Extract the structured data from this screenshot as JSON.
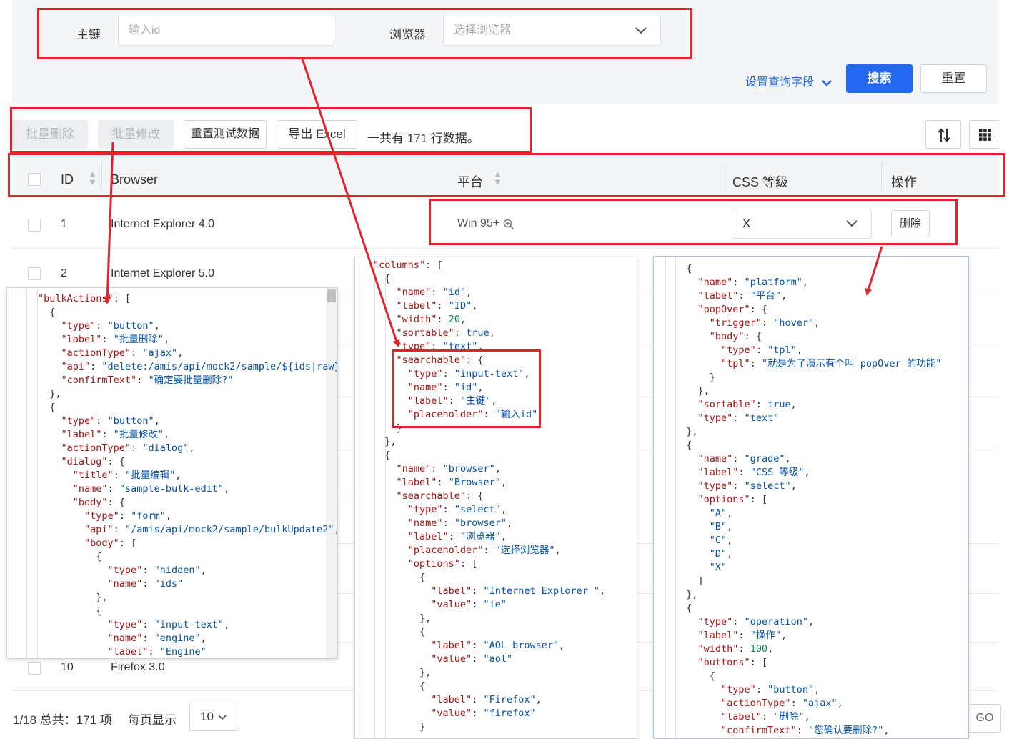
{
  "search": {
    "id_label": "主键",
    "id_placeholder": "输入id",
    "browser_label": "浏览器",
    "browser_placeholder": "选择浏览器",
    "set_fields": "设置查询字段",
    "search_button": "搜索",
    "reset_button": "重置"
  },
  "toolbar": {
    "bulk_delete": "批量删除",
    "bulk_edit": "批量修改",
    "reset_data": "重置测试数据",
    "export_excel": "导出 Excel",
    "summary": "一共有 171 行数据。"
  },
  "table": {
    "headers": {
      "id": "ID",
      "browser": "Browser",
      "platform": "平台",
      "grade": "CSS 等级",
      "operation": "操作"
    },
    "rows": [
      {
        "id": "1",
        "browser": "Internet Explorer 4.0",
        "platform": "Win 95+",
        "grade": "X",
        "action": "删除"
      },
      {
        "id": "2",
        "browser": "Internet Explorer 5.0"
      },
      {
        "id": "10",
        "browser": "Firefox 3.0"
      }
    ]
  },
  "pager": {
    "summary": "1/18 总共：171 项",
    "per_page_label": "每页显示",
    "per_page_value": "10",
    "go": "GO"
  },
  "code_left": [
    [
      [
        "k",
        "\"bulkActions\""
      ],
      [
        "p",
        ": ["
      ]
    ],
    [
      [
        "p",
        "  {"
      ]
    ],
    [
      [
        "p",
        "    "
      ],
      [
        "k",
        "\"type\""
      ],
      [
        "p",
        ": "
      ],
      [
        "s",
        "\"button\""
      ],
      [
        "p",
        ","
      ]
    ],
    [
      [
        "p",
        "    "
      ],
      [
        "k",
        "\"label\""
      ],
      [
        "p",
        ": "
      ],
      [
        "s",
        "\"批量删除\""
      ],
      [
        "p",
        ","
      ]
    ],
    [
      [
        "p",
        "    "
      ],
      [
        "k",
        "\"actionType\""
      ],
      [
        "p",
        ": "
      ],
      [
        "s",
        "\"ajax\""
      ],
      [
        "p",
        ","
      ]
    ],
    [
      [
        "p",
        "    "
      ],
      [
        "k",
        "\"api\""
      ],
      [
        "p",
        ": "
      ],
      [
        "s",
        "\"delete:/amis/api/mock2/sample/${ids|raw}\""
      ],
      [
        "p",
        ","
      ]
    ],
    [
      [
        "p",
        "    "
      ],
      [
        "k",
        "\"confirmText\""
      ],
      [
        "p",
        ": "
      ],
      [
        "s",
        "\"确定要批量删除?\""
      ]
    ],
    [
      [
        "p",
        "  },"
      ]
    ],
    [
      [
        "p",
        "  {"
      ]
    ],
    [
      [
        "p",
        "    "
      ],
      [
        "k",
        "\"type\""
      ],
      [
        "p",
        ": "
      ],
      [
        "s",
        "\"button\""
      ],
      [
        "p",
        ","
      ]
    ],
    [
      [
        "p",
        "    "
      ],
      [
        "k",
        "\"label\""
      ],
      [
        "p",
        ": "
      ],
      [
        "s",
        "\"批量修改\""
      ],
      [
        "p",
        ","
      ]
    ],
    [
      [
        "p",
        "    "
      ],
      [
        "k",
        "\"actionType\""
      ],
      [
        "p",
        ": "
      ],
      [
        "s",
        "\"dialog\""
      ],
      [
        "p",
        ","
      ]
    ],
    [
      [
        "p",
        "    "
      ],
      [
        "k",
        "\"dialog\""
      ],
      [
        "p",
        ": {"
      ]
    ],
    [
      [
        "p",
        "      "
      ],
      [
        "k",
        "\"title\""
      ],
      [
        "p",
        ": "
      ],
      [
        "s",
        "\"批量编辑\""
      ],
      [
        "p",
        ","
      ]
    ],
    [
      [
        "p",
        "      "
      ],
      [
        "k",
        "\"name\""
      ],
      [
        "p",
        ": "
      ],
      [
        "s",
        "\"sample-bulk-edit\""
      ],
      [
        "p",
        ","
      ]
    ],
    [
      [
        "p",
        "      "
      ],
      [
        "k",
        "\"body\""
      ],
      [
        "p",
        ": {"
      ]
    ],
    [
      [
        "p",
        "        "
      ],
      [
        "k",
        "\"type\""
      ],
      [
        "p",
        ": "
      ],
      [
        "s",
        "\"form\""
      ],
      [
        "p",
        ","
      ]
    ],
    [
      [
        "p",
        "        "
      ],
      [
        "k",
        "\"api\""
      ],
      [
        "p",
        ": "
      ],
      [
        "s",
        "\"/amis/api/mock2/sample/bulkUpdate2\""
      ],
      [
        "p",
        ","
      ]
    ],
    [
      [
        "p",
        "        "
      ],
      [
        "k",
        "\"body\""
      ],
      [
        "p",
        ": ["
      ]
    ],
    [
      [
        "p",
        "          {"
      ]
    ],
    [
      [
        "p",
        "            "
      ],
      [
        "k",
        "\"type\""
      ],
      [
        "p",
        ": "
      ],
      [
        "s",
        "\"hidden\""
      ],
      [
        "p",
        ","
      ]
    ],
    [
      [
        "p",
        "            "
      ],
      [
        "k",
        "\"name\""
      ],
      [
        "p",
        ": "
      ],
      [
        "s",
        "\"ids\""
      ]
    ],
    [
      [
        "p",
        "          },"
      ]
    ],
    [
      [
        "p",
        "          {"
      ]
    ],
    [
      [
        "p",
        "            "
      ],
      [
        "k",
        "\"type\""
      ],
      [
        "p",
        ": "
      ],
      [
        "s",
        "\"input-text\""
      ],
      [
        "p",
        ","
      ]
    ],
    [
      [
        "p",
        "            "
      ],
      [
        "k",
        "\"name\""
      ],
      [
        "p",
        ": "
      ],
      [
        "s",
        "\"engine\""
      ],
      [
        "p",
        ","
      ]
    ],
    [
      [
        "p",
        "            "
      ],
      [
        "k",
        "\"label\""
      ],
      [
        "p",
        ": "
      ],
      [
        "s",
        "\"Engine\""
      ]
    ]
  ],
  "code_middle": [
    [
      [
        "k",
        "\"columns\""
      ],
      [
        "p",
        ": ["
      ]
    ],
    [
      [
        "p",
        "  {"
      ]
    ],
    [
      [
        "p",
        "    "
      ],
      [
        "k",
        "\"name\""
      ],
      [
        "p",
        ": "
      ],
      [
        "s",
        "\"id\""
      ],
      [
        "p",
        ","
      ]
    ],
    [
      [
        "p",
        "    "
      ],
      [
        "k",
        "\"label\""
      ],
      [
        "p",
        ": "
      ],
      [
        "s",
        "\"ID\""
      ],
      [
        "p",
        ","
      ]
    ],
    [
      [
        "p",
        "    "
      ],
      [
        "k",
        "\"width\""
      ],
      [
        "p",
        ": "
      ],
      [
        "n",
        "20"
      ],
      [
        "p",
        ","
      ]
    ],
    [
      [
        "p",
        "    "
      ],
      [
        "k",
        "\"sortable\""
      ],
      [
        "p",
        ": "
      ],
      [
        "s",
        "true"
      ],
      [
        "p",
        ","
      ]
    ],
    [
      [
        "p",
        "    "
      ],
      [
        "k",
        "\"type\""
      ],
      [
        "p",
        ": "
      ],
      [
        "s",
        "\"text\""
      ],
      [
        "p",
        ","
      ]
    ],
    [
      [
        "p",
        "    "
      ],
      [
        "k",
        "\"searchable\""
      ],
      [
        "p",
        ": {"
      ]
    ],
    [
      [
        "p",
        "      "
      ],
      [
        "k",
        "\"type\""
      ],
      [
        "p",
        ": "
      ],
      [
        "s",
        "\"input-text\""
      ],
      [
        "p",
        ","
      ]
    ],
    [
      [
        "p",
        "      "
      ],
      [
        "k",
        "\"name\""
      ],
      [
        "p",
        ": "
      ],
      [
        "s",
        "\"id\""
      ],
      [
        "p",
        ","
      ]
    ],
    [
      [
        "p",
        "      "
      ],
      [
        "k",
        "\"label\""
      ],
      [
        "p",
        ": "
      ],
      [
        "s",
        "\"主键\""
      ],
      [
        "p",
        ","
      ]
    ],
    [
      [
        "p",
        "      "
      ],
      [
        "k",
        "\"placeholder\""
      ],
      [
        "p",
        ": "
      ],
      [
        "s",
        "\"输入id\""
      ]
    ],
    [
      [
        "p",
        "    }"
      ]
    ],
    [
      [
        "p",
        "  },"
      ]
    ],
    [
      [
        "p",
        "  {"
      ]
    ],
    [
      [
        "p",
        "    "
      ],
      [
        "k",
        "\"name\""
      ],
      [
        "p",
        ": "
      ],
      [
        "s",
        "\"browser\""
      ],
      [
        "p",
        ","
      ]
    ],
    [
      [
        "p",
        "    "
      ],
      [
        "k",
        "\"label\""
      ],
      [
        "p",
        ": "
      ],
      [
        "s",
        "\"Browser\""
      ],
      [
        "p",
        ","
      ]
    ],
    [
      [
        "p",
        "    "
      ],
      [
        "k",
        "\"searchable\""
      ],
      [
        "p",
        ": {"
      ]
    ],
    [
      [
        "p",
        "      "
      ],
      [
        "k",
        "\"type\""
      ],
      [
        "p",
        ": "
      ],
      [
        "s",
        "\"select\""
      ],
      [
        "p",
        ","
      ]
    ],
    [
      [
        "p",
        "      "
      ],
      [
        "k",
        "\"name\""
      ],
      [
        "p",
        ": "
      ],
      [
        "s",
        "\"browser\""
      ],
      [
        "p",
        ","
      ]
    ],
    [
      [
        "p",
        "      "
      ],
      [
        "k",
        "\"label\""
      ],
      [
        "p",
        ": "
      ],
      [
        "s",
        "\"浏览器\""
      ],
      [
        "p",
        ","
      ]
    ],
    [
      [
        "p",
        "      "
      ],
      [
        "k",
        "\"placeholder\""
      ],
      [
        "p",
        ": "
      ],
      [
        "s",
        "\"选择浏览器\""
      ],
      [
        "p",
        ","
      ]
    ],
    [
      [
        "p",
        "      "
      ],
      [
        "k",
        "\"options\""
      ],
      [
        "p",
        ": ["
      ]
    ],
    [
      [
        "p",
        "        {"
      ]
    ],
    [
      [
        "p",
        "          "
      ],
      [
        "k",
        "\"label\""
      ],
      [
        "p",
        ": "
      ],
      [
        "s",
        "\"Internet Explorer \""
      ],
      [
        "p",
        ","
      ]
    ],
    [
      [
        "p",
        "          "
      ],
      [
        "k",
        "\"value\""
      ],
      [
        "p",
        ": "
      ],
      [
        "s",
        "\"ie\""
      ]
    ],
    [
      [
        "p",
        "        },"
      ]
    ],
    [
      [
        "p",
        "        {"
      ]
    ],
    [
      [
        "p",
        "          "
      ],
      [
        "k",
        "\"label\""
      ],
      [
        "p",
        ": "
      ],
      [
        "s",
        "\"AOL browser\""
      ],
      [
        "p",
        ","
      ]
    ],
    [
      [
        "p",
        "          "
      ],
      [
        "k",
        "\"value\""
      ],
      [
        "p",
        ": "
      ],
      [
        "s",
        "\"aol\""
      ]
    ],
    [
      [
        "p",
        "        },"
      ]
    ],
    [
      [
        "p",
        "        {"
      ]
    ],
    [
      [
        "p",
        "          "
      ],
      [
        "k",
        "\"label\""
      ],
      [
        "p",
        ": "
      ],
      [
        "s",
        "\"Firefox\""
      ],
      [
        "p",
        ","
      ]
    ],
    [
      [
        "p",
        "          "
      ],
      [
        "k",
        "\"value\""
      ],
      [
        "p",
        ": "
      ],
      [
        "s",
        "\"firefox\""
      ]
    ],
    [
      [
        "p",
        "        }"
      ]
    ]
  ],
  "code_right": [
    [
      [
        "p",
        "  {"
      ]
    ],
    [
      [
        "p",
        "    "
      ],
      [
        "k",
        "\"name\""
      ],
      [
        "p",
        ": "
      ],
      [
        "s",
        "\"platform\""
      ],
      [
        "p",
        ","
      ]
    ],
    [
      [
        "p",
        "    "
      ],
      [
        "k",
        "\"label\""
      ],
      [
        "p",
        ": "
      ],
      [
        "s",
        "\"平台\""
      ],
      [
        "p",
        ","
      ]
    ],
    [
      [
        "p",
        "    "
      ],
      [
        "k",
        "\"popOver\""
      ],
      [
        "p",
        ": {"
      ]
    ],
    [
      [
        "p",
        "      "
      ],
      [
        "k",
        "\"trigger\""
      ],
      [
        "p",
        ": "
      ],
      [
        "s",
        "\"hover\""
      ],
      [
        "p",
        ","
      ]
    ],
    [
      [
        "p",
        "      "
      ],
      [
        "k",
        "\"body\""
      ],
      [
        "p",
        ": {"
      ]
    ],
    [
      [
        "p",
        "        "
      ],
      [
        "k",
        "\"type\""
      ],
      [
        "p",
        ": "
      ],
      [
        "s",
        "\"tpl\""
      ],
      [
        "p",
        ","
      ]
    ],
    [
      [
        "p",
        "        "
      ],
      [
        "k",
        "\"tpl\""
      ],
      [
        "p",
        ": "
      ],
      [
        "s",
        "\"就是为了演示有个叫 popOver 的功能\""
      ]
    ],
    [
      [
        "p",
        "      }"
      ]
    ],
    [
      [
        "p",
        "    },"
      ]
    ],
    [
      [
        "p",
        "    "
      ],
      [
        "k",
        "\"sortable\""
      ],
      [
        "p",
        ": "
      ],
      [
        "s",
        "true"
      ],
      [
        "p",
        ","
      ]
    ],
    [
      [
        "p",
        "    "
      ],
      [
        "k",
        "\"type\""
      ],
      [
        "p",
        ": "
      ],
      [
        "s",
        "\"text\""
      ]
    ],
    [
      [
        "p",
        "  },"
      ]
    ],
    [
      [
        "p",
        "  {"
      ]
    ],
    [
      [
        "p",
        "    "
      ],
      [
        "k",
        "\"name\""
      ],
      [
        "p",
        ": "
      ],
      [
        "s",
        "\"grade\""
      ],
      [
        "p",
        ","
      ]
    ],
    [
      [
        "p",
        "    "
      ],
      [
        "k",
        "\"label\""
      ],
      [
        "p",
        ": "
      ],
      [
        "s",
        "\"CSS 等级\""
      ],
      [
        "p",
        ","
      ]
    ],
    [
      [
        "p",
        "    "
      ],
      [
        "k",
        "\"type\""
      ],
      [
        "p",
        ": "
      ],
      [
        "s",
        "\"select\""
      ],
      [
        "p",
        ","
      ]
    ],
    [
      [
        "p",
        "    "
      ],
      [
        "k",
        "\"options\""
      ],
      [
        "p",
        ": ["
      ]
    ],
    [
      [
        "p",
        "      "
      ],
      [
        "s",
        "\"A\""
      ],
      [
        "p",
        ","
      ]
    ],
    [
      [
        "p",
        "      "
      ],
      [
        "s",
        "\"B\""
      ],
      [
        "p",
        ","
      ]
    ],
    [
      [
        "p",
        "      "
      ],
      [
        "s",
        "\"C\""
      ],
      [
        "p",
        ","
      ]
    ],
    [
      [
        "p",
        "      "
      ],
      [
        "s",
        "\"D\""
      ],
      [
        "p",
        ","
      ]
    ],
    [
      [
        "p",
        "      "
      ],
      [
        "s",
        "\"X\""
      ]
    ],
    [
      [
        "p",
        "    ]"
      ]
    ],
    [
      [
        "p",
        "  },"
      ]
    ],
    [
      [
        "p",
        "  {"
      ]
    ],
    [
      [
        "p",
        "    "
      ],
      [
        "k",
        "\"type\""
      ],
      [
        "p",
        ": "
      ],
      [
        "s",
        "\"operation\""
      ],
      [
        "p",
        ","
      ]
    ],
    [
      [
        "p",
        "    "
      ],
      [
        "k",
        "\"label\""
      ],
      [
        "p",
        ": "
      ],
      [
        "s",
        "\"操作\""
      ],
      [
        "p",
        ","
      ]
    ],
    [
      [
        "p",
        "    "
      ],
      [
        "k",
        "\"width\""
      ],
      [
        "p",
        ": "
      ],
      [
        "n",
        "100"
      ],
      [
        "p",
        ","
      ]
    ],
    [
      [
        "p",
        "    "
      ],
      [
        "k",
        "\"buttons\""
      ],
      [
        "p",
        ": ["
      ]
    ],
    [
      [
        "p",
        "      {"
      ]
    ],
    [
      [
        "p",
        "        "
      ],
      [
        "k",
        "\"type\""
      ],
      [
        "p",
        ": "
      ],
      [
        "s",
        "\"button\""
      ],
      [
        "p",
        ","
      ]
    ],
    [
      [
        "p",
        "        "
      ],
      [
        "k",
        "\"actionType\""
      ],
      [
        "p",
        ": "
      ],
      [
        "s",
        "\"ajax\""
      ],
      [
        "p",
        ","
      ]
    ],
    [
      [
        "p",
        "        "
      ],
      [
        "k",
        "\"label\""
      ],
      [
        "p",
        ": "
      ],
      [
        "s",
        "\"删除\""
      ],
      [
        "p",
        ","
      ]
    ],
    [
      [
        "p",
        "        "
      ],
      [
        "k",
        "\"confirmText\""
      ],
      [
        "p",
        ": "
      ],
      [
        "s",
        "\"您确认要删除?\""
      ],
      [
        "p",
        ","
      ]
    ]
  ],
  "colors": {
    "accent": "#2468f2",
    "annotation": "#e3232c",
    "code_key": "#a31515",
    "code_string": "#0451a5",
    "code_number": "#098658"
  }
}
